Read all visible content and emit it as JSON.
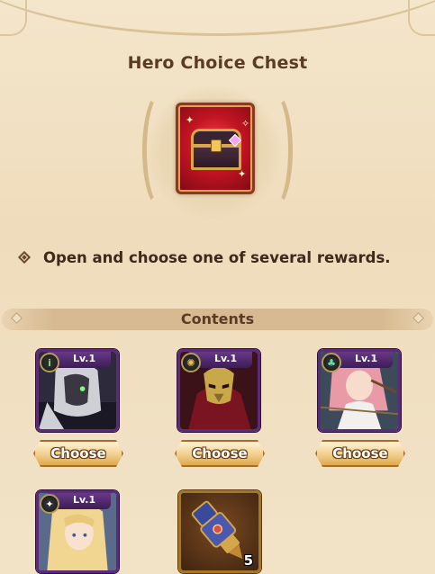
{
  "title": "Hero Choice Chest",
  "description": "Open and choose one of several rewards.",
  "contents_label": "Contents",
  "heroes": [
    {
      "level": "Lv.1",
      "faction_icon": "lightbearer-green-icon",
      "choose_label": "Choose"
    },
    {
      "level": "Lv.1",
      "faction_icon": "graveborn-gold-icon",
      "choose_label": "Choose"
    },
    {
      "level": "Lv.1",
      "faction_icon": "wilder-green-icon",
      "choose_label": "Choose"
    },
    {
      "level": "Lv.1",
      "faction_icon": "celestial-star-icon",
      "choose_label": ""
    }
  ],
  "item": {
    "icon": "gauntlet-icon",
    "count": "5"
  },
  "colors": {
    "background": "#f1e2c6",
    "text_dark": "#5a3b24",
    "card_border": "#5b2a7a",
    "button_gold": "#f1cf8e",
    "chest_red": "#c31423"
  }
}
